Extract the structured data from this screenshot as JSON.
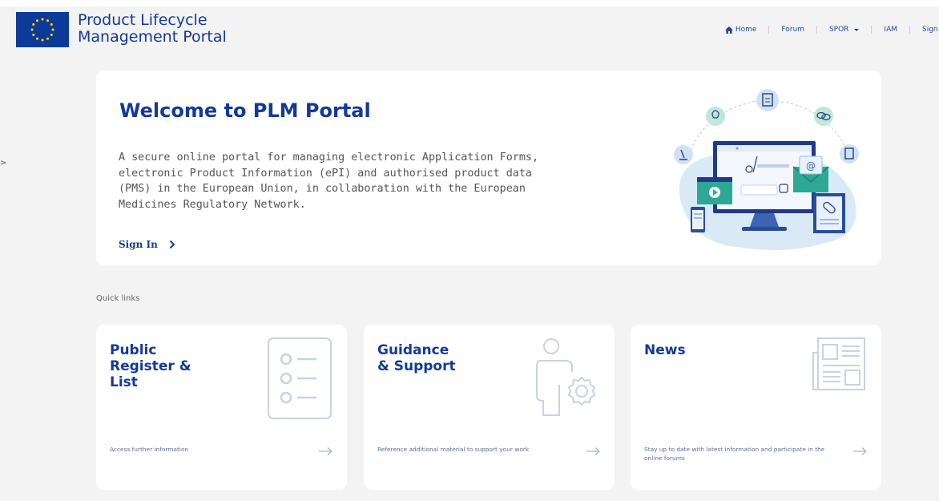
{
  "header": {
    "title_line1": "Product Lifecycle",
    "title_line2": "Management Portal",
    "logo_icon": "eu-flag-icon",
    "nav": [
      {
        "label": "Home",
        "icon": "home-icon"
      },
      {
        "label": "Forum"
      },
      {
        "label": "SPOR",
        "icon": "caret-down-icon"
      },
      {
        "label": "IAM"
      },
      {
        "label": "Sign i"
      }
    ]
  },
  "left_mark": ">",
  "hero": {
    "title": "Welcome to PLM Portal",
    "description": "A secure online portal for managing electronic Application Forms, electronic Product Information (ePI) and authorised product data (PMS) in the European Union, in collaboration with the European Medicines Regulatory Network.",
    "signin_label": "Sign In",
    "illustration_icon": "computer-medical-illustration"
  },
  "quick_links": {
    "label": "Quick links",
    "cards": [
      {
        "title_lines": [
          "Public",
          "Register &",
          "List"
        ],
        "description": "Access further information",
        "icon": "list-icon"
      },
      {
        "title_lines": [
          "Guidance",
          "& Support"
        ],
        "description": "Reference additional material to support your work",
        "icon": "person-gear-icon"
      },
      {
        "title_lines": [
          "News"
        ],
        "description": "Stay up to date with latest information and participate in the online forums",
        "icon": "newspaper-icon"
      }
    ]
  },
  "colors": {
    "brand_blue": "#14399a",
    "background": "#f3f3f4",
    "card_bg": "#ffffff",
    "icon_outline": "#c8d2e4",
    "flag_blue": "#0b3a9a",
    "flag_star": "#ffd800"
  }
}
